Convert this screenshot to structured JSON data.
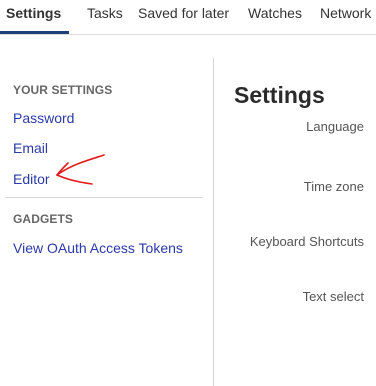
{
  "tabs": [
    {
      "label": "Settings",
      "active": true
    },
    {
      "label": "Tasks",
      "active": false
    },
    {
      "label": "Saved for later",
      "active": false
    },
    {
      "label": "Watches",
      "active": false
    },
    {
      "label": "Network",
      "active": false
    }
  ],
  "sidebar": {
    "your_settings_heading": "YOUR SETTINGS",
    "your_settings_items": [
      {
        "label": "Password"
      },
      {
        "label": "Email"
      },
      {
        "label": "Editor"
      }
    ],
    "gadgets_heading": "GADGETS",
    "gadgets_items": [
      {
        "label": "View OAuth Access Tokens"
      }
    ]
  },
  "main": {
    "title": "Settings",
    "labels": [
      "Language",
      "Time zone",
      "Keyboard Shortcuts",
      "Text select"
    ]
  },
  "colors": {
    "link": "#2a3aa8",
    "active_tab_underline": "#1f3f77",
    "annotation_arrow": "#e31b1b"
  },
  "annotation": {
    "icon": "red-arrow-icon"
  }
}
